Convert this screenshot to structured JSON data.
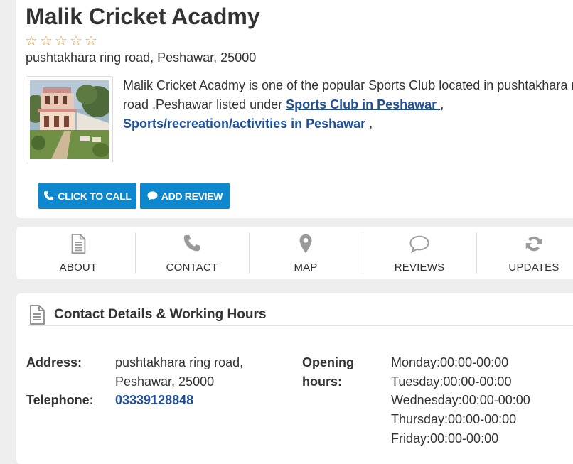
{
  "listing": {
    "name": "Malik Cricket Acadmy",
    "rating_stars": 0,
    "rating_max": 5,
    "address_line": "pushtakhara ring road, Peshawar, 25000",
    "description_prefix": "Malik Cricket Acadmy is one of the popular Sports Club located in pushtakhara ring road ,Peshawar listed under ",
    "category_1": "Sports Club in Peshawar ",
    "separator_1": " ,",
    "category_2": "Sports/recreation/activities in Peshawar ",
    "separator_2": " ,"
  },
  "actions": {
    "call_label": "CLICK TO CALL",
    "review_label": "ADD REVIEW"
  },
  "nav": {
    "items": [
      {
        "label": "ABOUT",
        "icon": "document-icon"
      },
      {
        "label": "CONTACT",
        "icon": "phone-icon"
      },
      {
        "label": "MAP",
        "icon": "map-pin-icon"
      },
      {
        "label": "REVIEWS",
        "icon": "speech-bubble-icon"
      },
      {
        "label": "UPDATES",
        "icon": "refresh-icon"
      }
    ]
  },
  "contact": {
    "section_title": "Contact Details & Working Hours",
    "address_label": "Address:",
    "address_value_1": "pushtakhara ring road,",
    "address_value_2": "Peshawar, 25000",
    "telephone_label": "Telephone:",
    "telephone_value": "03339128848",
    "opening_label_1": "Opening",
    "opening_label_2": "hours:",
    "hours": [
      "Monday:00:00-00:00",
      "Tuesday:00:00-00:00",
      "Wednesday:00:00-00:00",
      "Thursday:00:00-00:00",
      "Friday:00:00-00:00"
    ]
  },
  "colors": {
    "accent_button": "#0d88cf",
    "link": "#1e4f9c",
    "star": "#e8a23a"
  }
}
